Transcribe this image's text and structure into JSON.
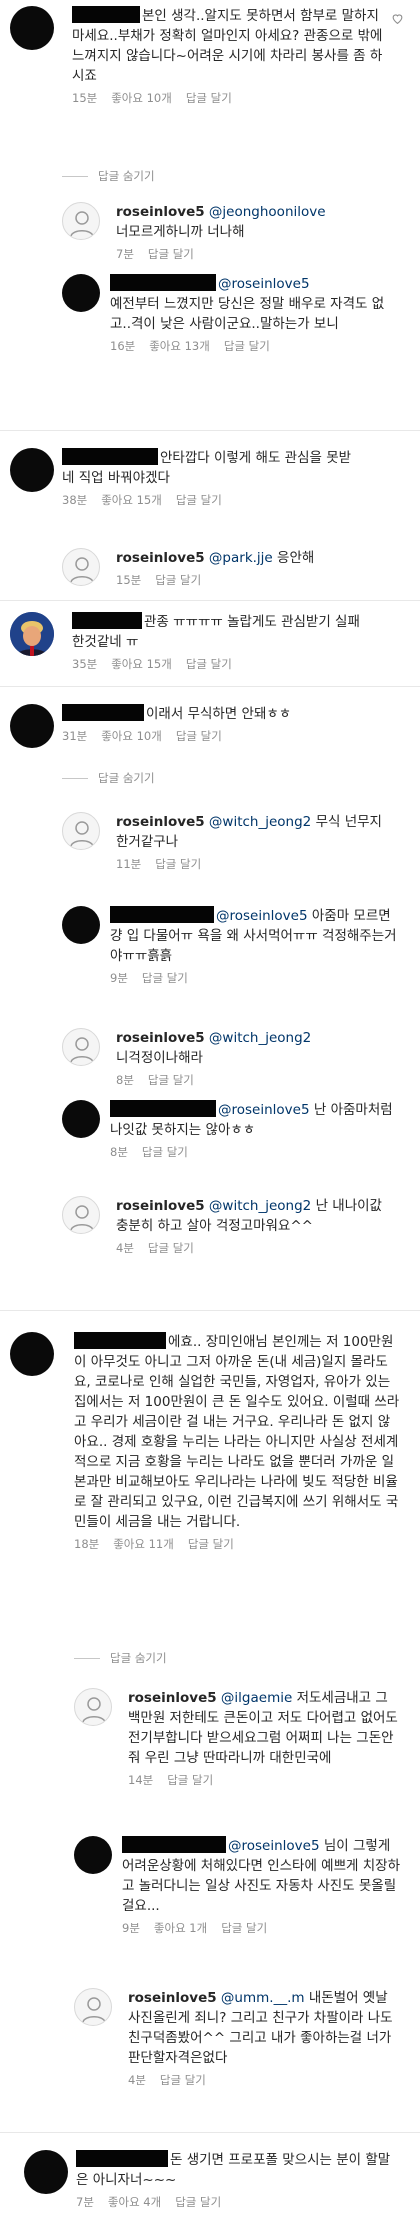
{
  "comments": [
    {
      "text": "본인 생각..알지도 못하면서 함부로 말하지 마세요..부채가 정확히 얼마인지 아세요? 관종으로 밖에 느껴지지 않습니다~어려운 시기에 차라리 봉사를 좀 하시죠",
      "time": "15분",
      "likes": "좋아요 10개",
      "reply": "답글 달기"
    },
    {
      "username": "roseinlove5",
      "mention": "@jeonghoonilove",
      "text": "너모르게하니까 너나해",
      "time": "7분",
      "reply": "답글 달기"
    },
    {
      "mention": "@roseinlove5",
      "text": "예전부터 느꼈지만 당신은 정말 배우로 자격도 없고..격이 낮은 사람이군요..말하는가 보니",
      "time": "16분",
      "likes": "좋아요 13개",
      "reply": "답글 달기"
    },
    {
      "text": "안타깝다 이렇게 해도 관심을 못받네 직업 바꿔야겠다",
      "time": "38분",
      "likes": "좋아요 15개",
      "reply": "답글 달기"
    },
    {
      "username": "roseinlove5",
      "mention": "@park.jje",
      "text": "응안해",
      "time": "15분",
      "reply": "답글 달기"
    },
    {
      "text": "관종 ㅠㅠㅠㅠ 놀랍게도 관심받기 실패한것같네 ㅠ",
      "time": "35분",
      "likes": "좋아요 15개",
      "reply": "답글 달기"
    },
    {
      "text": "이래서 무식하면 안돼ㅎㅎ",
      "time": "31분",
      "likes": "좋아요 10개",
      "reply": "답글 달기"
    },
    {
      "username": "roseinlove5",
      "mention": "@witch_jeong2",
      "text": "무식 넌무지한거같구나",
      "time": "11분",
      "reply": "답글 달기"
    },
    {
      "mention": "@roseinlove5",
      "text": "아줌마 모르면 걍 입 다물어ㅠ 욕을 왜 사서먹어ㅠㅠ 걱정해주는거야ㅠㅠ흙흙",
      "time": "9분",
      "reply": "답글 달기"
    },
    {
      "username": "roseinlove5",
      "mention": "@witch_jeong2",
      "text": "니걱정이나해라",
      "time": "8분",
      "reply": "답글 달기"
    },
    {
      "mention": "@roseinlove5",
      "text": "난 아줌마처럼 나잇값 못하지는 않아ㅎㅎ",
      "time": "8분",
      "reply": "답글 달기"
    },
    {
      "username": "roseinlove5",
      "mention": "@witch_jeong2",
      "text": "난 내나이값충분히 하고 살아 걱정고마워요^^",
      "time": "4분",
      "reply": "답글 달기"
    },
    {
      "text": "에효.. 장미인애님 본인께는 저 100만원이 아무것도 아니고 그저 아까운 돈(내 세금)일지 몰라도요, 코로나로 인해 실업한 국민들, 자영업자, 유아가 있는 집에서는 저 100만원이 큰 돈 일수도 있어요. 이럴때 쓰라고 우리가 세금이란 걸 내는 거구요. 우리나라 돈 없지 않아요.. 경제 호황을 누리는 나라는 아니지만 사실상 전세계적으로 지금 호황을 누리는 나라도 없을 뿐더러 가까운 일본과만 비교해보아도 우리나라는 나라에 빚도 적당한 비율로 잘 관리되고 있구요, 이런 긴급복지에 쓰기 위해서도 국민들이 세금을 내는 거랍니다.",
      "time": "18분",
      "likes": "좋아요 11개",
      "reply": "답글 달기"
    },
    {
      "username": "roseinlove5",
      "mention": "@ilgaemie",
      "text": "저도세금내고 그백만원 저한테도 큰돈이고 저도 다어렵고 없어도 전기부합니다 받으세요그럼 어쩌피 나는 그돈안줘 우린 그냥 딴따라니까 대한민국에",
      "time": "14분",
      "reply": "답글 달기"
    },
    {
      "mention": "@roseinlove5",
      "text": "님이 그렇게 어려운상황에 처해있다면 인스타에 예쁘게 치장하고 놀러다니는 일상 사진도 자동차 사진도 못올릴걸요...",
      "time": "9분",
      "likes": "좋아요 1개",
      "reply": "답글 달기"
    },
    {
      "username": "roseinlove5",
      "mention": "@umm.__.m",
      "text": "내돈벌어 옛날사진올린게 죄니? 그리고 친구가 차팔이라 나도 친구덕좀봤어^^ 그리고 내가 좋아하는걸 너가 판단할자격은없다",
      "time": "4분",
      "reply": "답글 달기"
    },
    {
      "text": "돈 생기면 프로포폴 맞으시는 분이 할말은 아니자너~~~",
      "time": "7분",
      "likes": "좋아요 4개",
      "reply": "답글 달기"
    }
  ],
  "toggle_label": "답글 숨기기"
}
